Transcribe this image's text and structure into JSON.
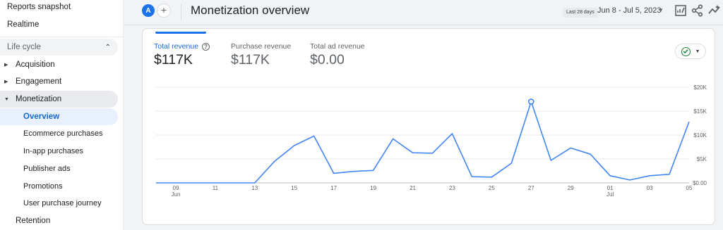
{
  "sidebar": {
    "reports_snapshot": "Reports snapshot",
    "realtime": "Realtime",
    "section_label": "Life cycle",
    "items": [
      {
        "label": "Acquisition"
      },
      {
        "label": "Engagement"
      },
      {
        "label": "Monetization"
      },
      {
        "label": "Retention"
      }
    ],
    "monetization_children": [
      {
        "label": "Overview"
      },
      {
        "label": "Ecommerce purchases"
      },
      {
        "label": "In-app purchases"
      },
      {
        "label": "Publisher ads"
      },
      {
        "label": "Promotions"
      },
      {
        "label": "User purchase journey"
      }
    ]
  },
  "header": {
    "avatar_letter": "A",
    "add_symbol": "+",
    "title": "Monetization overview",
    "range_chip": "Last 28 days",
    "date_range": "Jun 8 - Jul 5, 2023",
    "icons": [
      "edit-report-icon",
      "share-icon",
      "insights-icon"
    ]
  },
  "metrics": [
    {
      "label": "Total revenue",
      "value": "$117K",
      "active": true
    },
    {
      "label": "Purchase revenue",
      "value": "$117K",
      "active": false
    },
    {
      "label": "Total ad revenue",
      "value": "$0.00",
      "active": false
    }
  ],
  "help_symbol": "?",
  "colors": {
    "accent": "#1a73e8",
    "line": "#4285f4",
    "check": "#188038"
  },
  "chart_data": {
    "type": "line",
    "x": [
      "Jun 8",
      "Jun 9",
      "Jun 10",
      "Jun 11",
      "Jun 12",
      "Jun 13",
      "Jun 14",
      "Jun 15",
      "Jun 16",
      "Jun 17",
      "Jun 18",
      "Jun 19",
      "Jun 20",
      "Jun 21",
      "Jun 22",
      "Jun 23",
      "Jun 24",
      "Jun 25",
      "Jun 26",
      "Jun 27",
      "Jun 28",
      "Jun 29",
      "Jun 30",
      "Jul 1",
      "Jul 2",
      "Jul 3",
      "Jul 4",
      "Jul 5"
    ],
    "values": [
      0,
      0,
      0,
      0,
      0,
      0,
      4500,
      7800,
      9800,
      2000,
      2400,
      2600,
      9200,
      6300,
      6200,
      10300,
      1300,
      1200,
      4100,
      17000,
      4700,
      7300,
      6000,
      1500,
      600,
      1500,
      1800,
      12800
    ],
    "x_tick_labels": [
      "09",
      "11",
      "13",
      "15",
      "17",
      "19",
      "21",
      "23",
      "25",
      "27",
      "29",
      "01",
      "03",
      "05"
    ],
    "x_month_labels": [
      {
        "label": "Jun",
        "at": "Jun 9"
      },
      {
        "label": "Jul",
        "at": "Jul 1"
      }
    ],
    "y_tick_labels": [
      "$20K",
      "$15K",
      "$10K",
      "$5K",
      "$0.00"
    ],
    "ylim": [
      0,
      20000
    ],
    "highlight_x": "Jun 27",
    "grid": true,
    "title": "",
    "xlabel": "",
    "ylabel": ""
  }
}
